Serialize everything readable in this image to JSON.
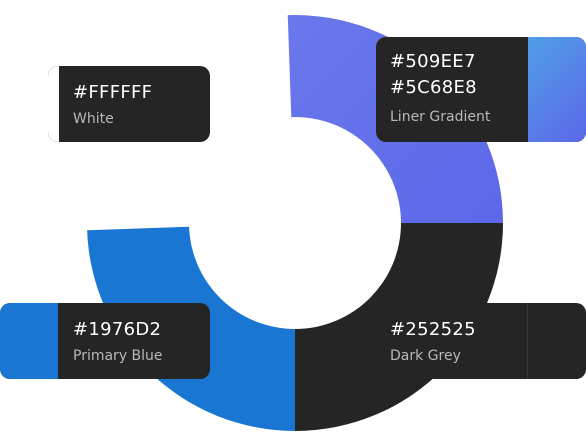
{
  "colors": [
    {
      "hex": "#FFFFFF",
      "name": "White",
      "swatch": "#FFFFFF"
    },
    {
      "hex": "#509EE7",
      "hex2": "#5C68E8",
      "name": "Liner Gradient",
      "swatch": "#509EE7",
      "swatch2": "#5C68E8"
    },
    {
      "hex": "#1976D2",
      "name": "Primary Blue",
      "swatch": "#1976D2"
    },
    {
      "hex": "#252525",
      "name": "Dark Grey",
      "swatch": "#252525"
    }
  ],
  "ring_colors": {
    "gradient_start": "#6A78EC",
    "gradient_end": "#5C68E8",
    "blue": "#1976D2",
    "grey": "#252525",
    "white": "#FFFFFF"
  }
}
